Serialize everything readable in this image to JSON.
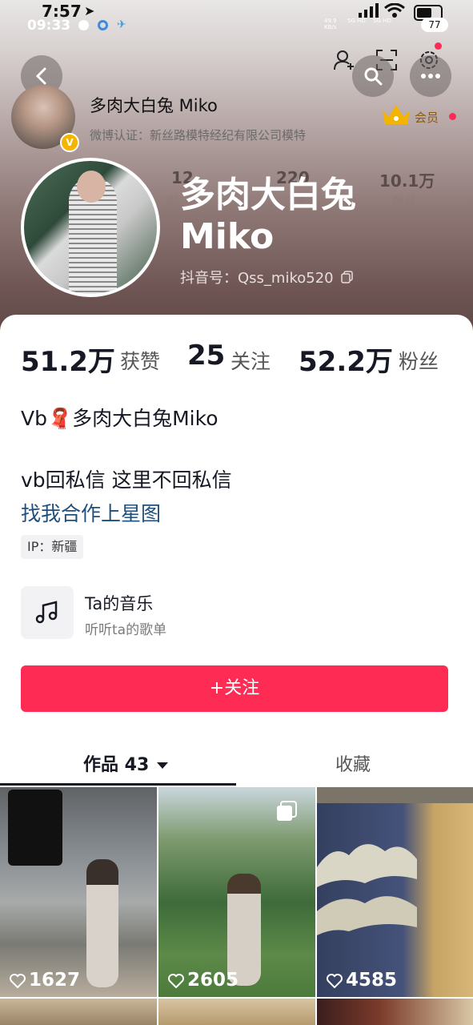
{
  "status_bar": {
    "time_main": "7:57",
    "time_sub": "09:33",
    "net_speed": "49.9",
    "net_unit": "KB/s",
    "signal_1": "5G HD",
    "signal_2": "5G HD",
    "battery": "77"
  },
  "header": {
    "mini_name": "多肉大白兔 Miko",
    "certification": "微博认证：新丝路模特经纪有限公司模特",
    "vip_label": "会员",
    "verified_badge": "V",
    "big_name": "多肉大白兔 Miko",
    "douyin_id": "抖音号：Qss_miko520",
    "ghost_stats": [
      "12",
      "220",
      "10.1万"
    ],
    "ghost_labels": [
      "视",
      "关",
      "粉丝"
    ]
  },
  "stats": {
    "likes_value": "51.2万",
    "likes_label": "获赞",
    "following_value": "25",
    "following_label": "关注",
    "followers_value": "52.2万",
    "followers_label": "粉丝"
  },
  "bio": {
    "line1": "Vb🧣多肉大白兔Miko",
    "line2": "vb回私信  这里不回私信",
    "link": "找我合作上星图",
    "ip": "IP：新疆"
  },
  "music": {
    "title": "Ta的音乐",
    "subtitle": "听听ta的歌单"
  },
  "follow_button": "+关注",
  "tabs": {
    "works": "作品 43",
    "favorites": "收藏"
  },
  "grid": [
    {
      "likes": "1627"
    },
    {
      "likes": "2605"
    },
    {
      "likes": "4585"
    }
  ],
  "colors": {
    "accent": "#fe2c55",
    "link": "#1f4f7c",
    "vip": "#f5b400"
  }
}
